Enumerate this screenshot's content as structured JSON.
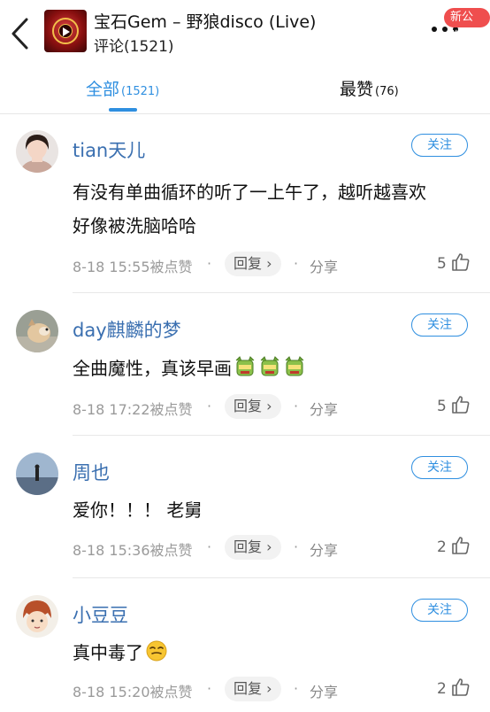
{
  "header": {
    "title": "宝石Gem – 野狼disco (Live)",
    "subtitle": "评论(1521)",
    "badge": "新公告"
  },
  "tabs": [
    {
      "label": "全部",
      "count": "(1521)",
      "active": true
    },
    {
      "label": "最赞",
      "count": "(76)",
      "active": false
    }
  ],
  "colors": {
    "accent": "#2f8fe0",
    "username": "#3a6fb0",
    "badge": "#ef4e4e"
  },
  "comments": [
    {
      "username": "tian天儿",
      "follow": "关注",
      "text_lines": [
        "有没有单曲循环的听了一上午了，越听越喜欢",
        "好像被洗脑哈哈"
      ],
      "time": "8-18 15:55被点赞",
      "reply": "回复 ›",
      "share": "分享",
      "likes": "5"
    },
    {
      "username": "day麒麟的梦",
      "follow": "关注",
      "text": "全曲魔性，真该早画",
      "emoji": [
        "dragon-mask-emoji",
        "dragon-mask-emoji",
        "dragon-mask-emoji"
      ],
      "time": "8-18 17:22被点赞",
      "reply": "回复 ›",
      "share": "分享",
      "likes": "5"
    },
    {
      "username": "周也",
      "follow": "关注",
      "text": "爱你！！！ 老舅",
      "time": "8-18 15:36被点赞",
      "reply": "回复 ›",
      "share": "分享",
      "likes": "2"
    },
    {
      "username": "小豆豆",
      "follow": "关注",
      "text": "真中毒了",
      "emoji": [
        "smirk-face-emoji"
      ],
      "time": "8-18 15:20被点赞",
      "reply": "回复 ›",
      "share": "分享",
      "likes": "2"
    }
  ]
}
